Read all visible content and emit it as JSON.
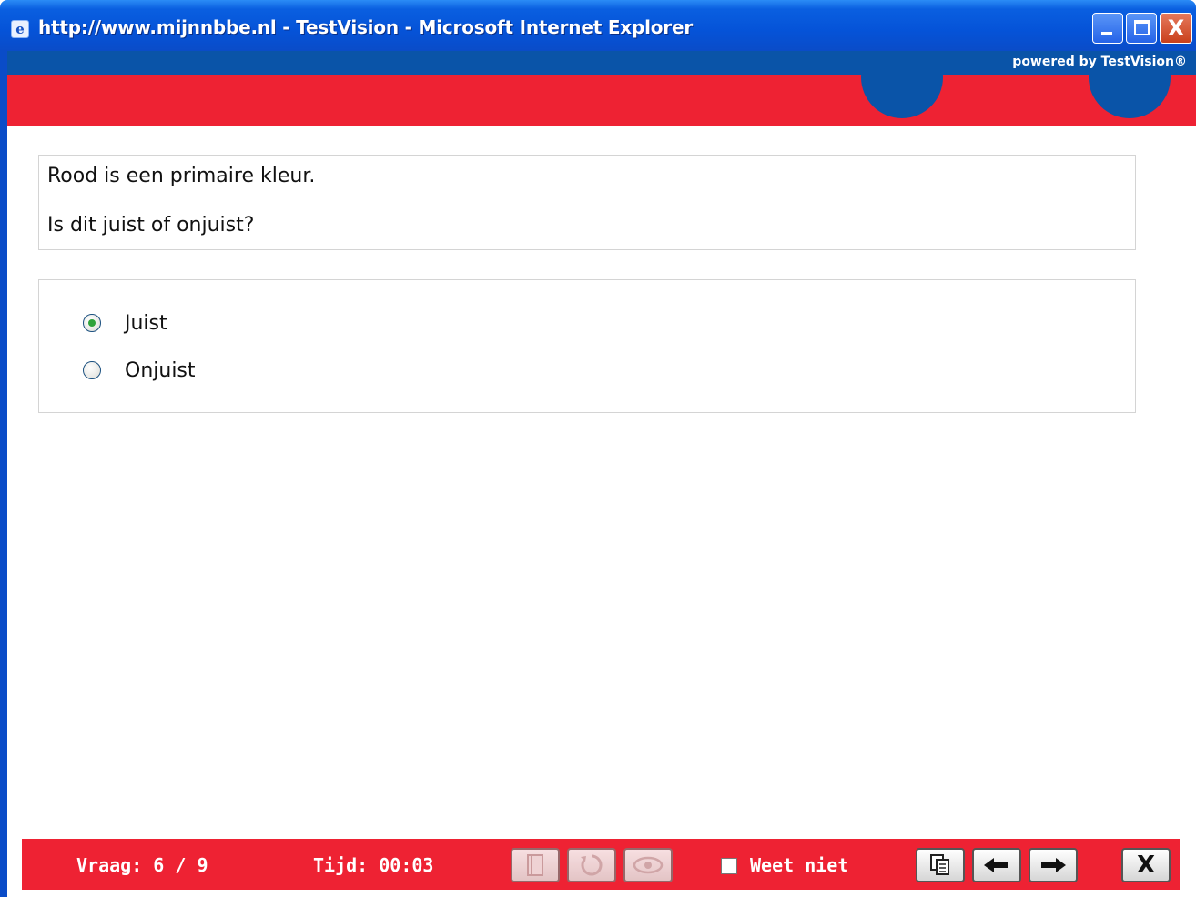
{
  "window": {
    "title": "http://www.mijnnbbe.nl - TestVision - Microsoft Internet Explorer",
    "close_glyph": "X"
  },
  "header": {
    "powered_by": "powered by TestVision®",
    "brand_blue": "#0a54a8",
    "brand_red": "#ee2233"
  },
  "question": {
    "statement": "Rood is een primaire kleur.",
    "prompt": "Is dit juist of onjuist?"
  },
  "answers": {
    "options": [
      {
        "label": "Juist",
        "selected": true
      },
      {
        "label": "Onjuist",
        "selected": false
      }
    ]
  },
  "toolbar": {
    "vraag": "Vraag: 6 / 9",
    "tijd": "Tijd: 00:03",
    "weet_niet_label": "Weet niet",
    "weet_niet_checked": false,
    "close_glyph": "X",
    "icons": [
      "book-icon",
      "reset-icon",
      "eye-icon",
      "overview-icon",
      "arrow-left-icon",
      "arrow-right-icon",
      "close-icon"
    ]
  }
}
